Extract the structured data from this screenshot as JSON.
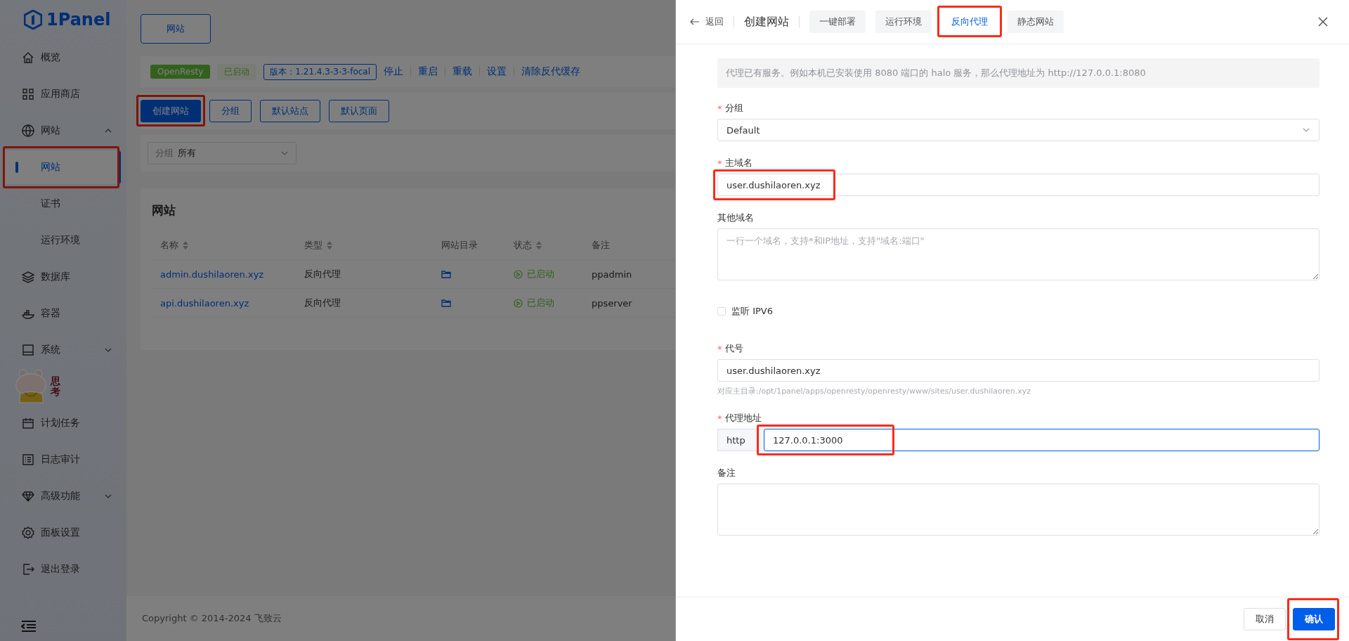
{
  "sidebar": {
    "logo": "1Panel",
    "items": [
      {
        "label": "概览"
      },
      {
        "label": "应用商店"
      },
      {
        "label": "网站",
        "expanded": true,
        "children": [
          {
            "label": "网站",
            "selected": true,
            "highlighted": true
          },
          {
            "label": "证书",
            "selected": false
          },
          {
            "label": "运行环境",
            "selected": false
          }
        ]
      },
      {
        "label": "数据库"
      },
      {
        "label": "容器"
      },
      {
        "label": "系统",
        "expanded": false
      },
      {
        "label": "计划任务"
      },
      {
        "label": "日志审计"
      },
      {
        "label": "高级功能",
        "expanded": false
      },
      {
        "label": "面板设置"
      },
      {
        "label": "退出登录"
      }
    ]
  },
  "sticker": {
    "text": "思考"
  },
  "page_tab": "网站",
  "app_status": {
    "name": "OpenResty",
    "status": "已启动",
    "version": "版本：1.21.4.3-3-3-focal",
    "actions": [
      "停止",
      "重启",
      "重载",
      "设置",
      "清除反代缓存"
    ]
  },
  "toolbar": [
    {
      "label": "创建网站",
      "primary": true,
      "highlighted": true
    },
    {
      "label": "分组",
      "primary": false
    },
    {
      "label": "默认站点",
      "primary": false
    },
    {
      "label": "默认页面",
      "primary": false
    }
  ],
  "filter": {
    "label": "分组",
    "value": "所有"
  },
  "table": {
    "title": "网站",
    "columns": [
      {
        "label": "名称",
        "sortable": true
      },
      {
        "label": "类型",
        "sortable": true
      },
      {
        "label": "网站目录",
        "sortable": false
      },
      {
        "label": "状态",
        "sortable": true
      },
      {
        "label": "备注",
        "sortable": false
      }
    ],
    "rows": [
      {
        "name": "admin.dushilaoren.xyz",
        "type": "反向代理",
        "status": "已启动",
        "remark": "ppadmin"
      },
      {
        "name": "api.dushilaoren.xyz",
        "type": "反向代理",
        "status": "已启动",
        "remark": "ppserver"
      }
    ]
  },
  "footer": "Copyright © 2014-2024 飞致云",
  "drawer": {
    "back": "返回",
    "title": "创建网站",
    "tabs": [
      {
        "label": "一键部署",
        "selected": false
      },
      {
        "label": "运行环境",
        "selected": false
      },
      {
        "label": "反向代理",
        "selected": true,
        "highlighted": true
      },
      {
        "label": "静态网站",
        "selected": false
      }
    ],
    "alert": "代理已有服务。例如本机已安装使用 8080 端口的 halo 服务，那么代理地址为 http://127.0.0.1:8080",
    "fields": [
      {
        "kind": "select",
        "label": "分组",
        "required_mark": "*",
        "value": "Default"
      },
      {
        "kind": "input",
        "label": "主域名",
        "required_mark": "*",
        "value": "user.dushilaoren.xyz",
        "highlighted": true
      },
      {
        "kind": "textarea",
        "label": "其他域名",
        "placeholder": "一行一个域名，支持*和IP地址，支持\"域名:端口\""
      },
      {
        "kind": "checkbox",
        "label": "监听 IPV6",
        "checked": false
      },
      {
        "kind": "input",
        "label": "代号",
        "required_mark": "*",
        "value": "user.dushilaoren.xyz",
        "hint": "对应主目录:/opt/1panel/apps/openresty/openresty/www/sites/user.dushilaoren.xyz"
      },
      {
        "kind": "proxy",
        "label": "代理地址",
        "required_mark": "*",
        "scheme": "http",
        "value": "127.0.0.1:3000",
        "focused": true,
        "highlighted": true
      },
      {
        "kind": "textarea",
        "label": "备注"
      }
    ],
    "buttons": [
      {
        "label": "取消",
        "primary": false
      },
      {
        "label": "确认",
        "primary": true,
        "highlighted": true
      }
    ]
  }
}
